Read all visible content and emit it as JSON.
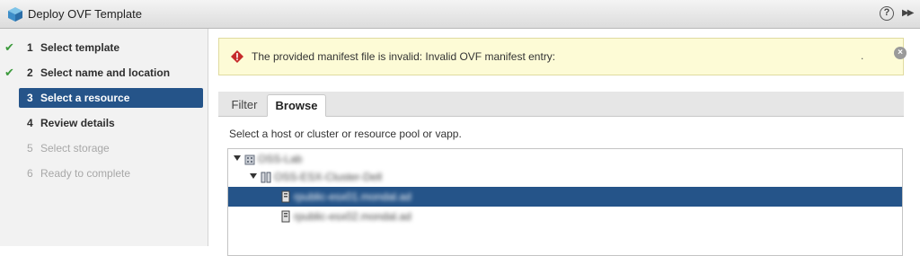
{
  "window": {
    "title": "Deploy OVF Template",
    "help_label": "?",
    "expand_label": "▶▶"
  },
  "steps": [
    {
      "num": "1",
      "label": "Select template",
      "state": "done"
    },
    {
      "num": "2",
      "label": "Select name and location",
      "state": "done"
    },
    {
      "num": "3",
      "label": "Select a resource",
      "state": "active"
    },
    {
      "num": "4",
      "label": "Review details",
      "state": "normal"
    },
    {
      "num": "5",
      "label": "Select storage",
      "state": "disabled"
    },
    {
      "num": "6",
      "label": "Ready to complete",
      "state": "disabled"
    }
  ],
  "alert": {
    "message": "The provided manifest file is invalid: Invalid OVF manifest entry:",
    "trailing": ".",
    "close_label": "×"
  },
  "tabs": [
    {
      "label": "Filter",
      "active": false
    },
    {
      "label": "Browse",
      "active": true
    }
  ],
  "instruction": "Select a host or cluster or resource pool or vapp.",
  "tree": {
    "datacenter": "OSS-Lab",
    "cluster": "OSS-ESX-Cluster-Dell",
    "hosts": [
      {
        "name": "rpublic-esx01.mondal.ad",
        "selected": true
      },
      {
        "name": "rpublic-esx02.mondal.ad",
        "selected": false
      }
    ]
  },
  "colors": {
    "accent": "#255489",
    "alert_bg": "#fdfbd6",
    "error_red": "#c62a2a",
    "check_green": "#3c9a3c"
  }
}
